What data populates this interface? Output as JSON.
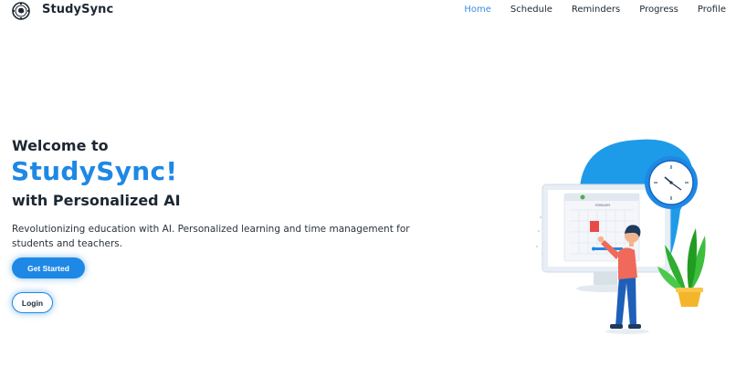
{
  "brand": {
    "name": "StudySync",
    "logo_icon": "brain-gear-icon"
  },
  "nav": {
    "items": [
      {
        "label": "Home",
        "active": true
      },
      {
        "label": "Schedule",
        "active": false
      },
      {
        "label": "Reminders",
        "active": false
      },
      {
        "label": "Progress",
        "active": false
      },
      {
        "label": "Profile",
        "active": false
      }
    ]
  },
  "hero": {
    "line1": "Welcome to",
    "line2": "StudySync!",
    "line3": "with Personalized AI",
    "description": "Revolutionizing education with AI. Personalized learning and time management for students and teachers.",
    "primary_button": "Get Started",
    "secondary_button": "Login"
  },
  "illustration": {
    "calendar_month": "FEBRUARY"
  },
  "colors": {
    "accent": "#1e88e5",
    "text": "#1d2733",
    "nav_active": "#3b8ee0"
  }
}
